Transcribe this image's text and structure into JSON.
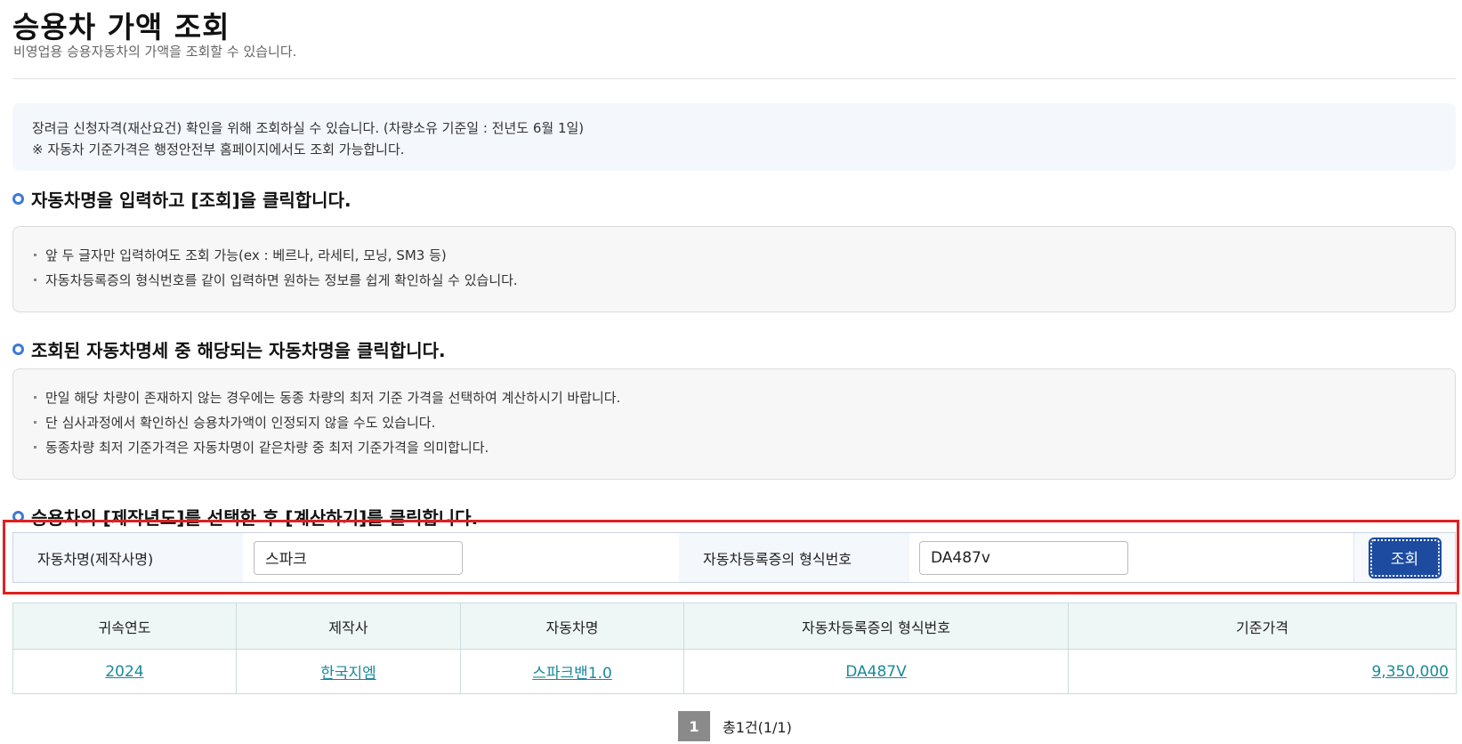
{
  "header": {
    "title": "승용차 가액 조회",
    "subtitle": "비영업용 승용자동차의 가액을 조회할 수 있습니다."
  },
  "notice": {
    "line1": "장려금 신청자격(재산요건) 확인을 위해 조회하실 수 있습니다. (차량소유 기준일 : 전년도 6월 1일)",
    "line2": "※ 자동차 기준가격은 행정안전부 홈페이지에서도 조회 가능합니다."
  },
  "step1": {
    "heading": "자동차명을 입력하고 [조회]을 클릭합니다.",
    "items": [
      "앞 두 글자만 입력하여도 조회 가능(ex : 베르나, 라세티, 모닝, SM3 등)",
      "자동차등록증의 형식번호를 같이 입력하면 원하는 정보를 쉽게 확인하실 수 있습니다."
    ]
  },
  "step2": {
    "heading": "조회된 자동차명세 중 해당되는 자동차명을 클릭합니다.",
    "items": [
      "만일 해당 차량이 존재하지 않는 경우에는 동종 차량의 최저 기준 가격을 선택하여 계산하시기 바랍니다.",
      "단 심사과정에서 확인하신 승용차가액이 인정되지 않을 수도 있습니다.",
      "동종차량 최저 기준가격은 자동차명이 같은차량 중  최저 기준가격을 의미합니다."
    ]
  },
  "step3": {
    "heading": "승용차의 [제작년도]를 선택한 후 [계산하기]를 클릭합니다."
  },
  "search": {
    "car_name_label": "자동차명(제작사명)",
    "car_name_value": "스파크",
    "model_code_label": "자동차등록증의 형식번호",
    "model_code_value": "DA487v",
    "button_label": "조회"
  },
  "table": {
    "columns": [
      "귀속연도",
      "제작사",
      "자동차명",
      "자동차등록증의 형식번호",
      "기준가격"
    ],
    "rows": [
      [
        "2024",
        "한국지엠",
        "스파크밴1.0",
        "DA487V",
        "9,350,000"
      ]
    ]
  },
  "pagination": {
    "current_page": "1",
    "total_text": "총1건(1/1)"
  },
  "colors": {
    "accent": "#1c4ba0",
    "highlight_border": "#e02020",
    "link": "#1a8a9a"
  }
}
